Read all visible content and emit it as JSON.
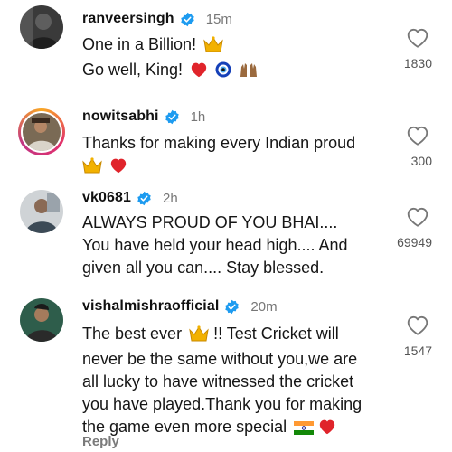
{
  "comments": [
    {
      "username": "ranveersingh",
      "time": "15m",
      "lines": [
        "One in a Billion!",
        "Go well, King!"
      ],
      "likes": "1830",
      "verified": true
    },
    {
      "username": "nowitsabhi",
      "time": "1h",
      "lines": [
        "Thanks for making every Indian proud"
      ],
      "likes": "300",
      "verified": true
    },
    {
      "username": "vk0681",
      "time": "2h",
      "lines": [
        "ALWAYS PROUD OF YOU BHAI....",
        "You have held your head high.... And",
        "given all you can.... Stay blessed."
      ],
      "likes": "69949",
      "verified": true
    },
    {
      "username": "vishalmishraofficial",
      "time": "20m",
      "lines": [
        "The best ever",
        "!! Test Cricket will",
        "never be the same without you,we are",
        "all lucky to have witnessed the cricket",
        "you have played.Thank you for making",
        "the game even more special"
      ],
      "likes": "1547",
      "verified": true
    }
  ],
  "reply_label": "Reply",
  "colors": {
    "verified": "#1d9bf0",
    "heart": "#e0242b",
    "crown": "#f2b100"
  }
}
